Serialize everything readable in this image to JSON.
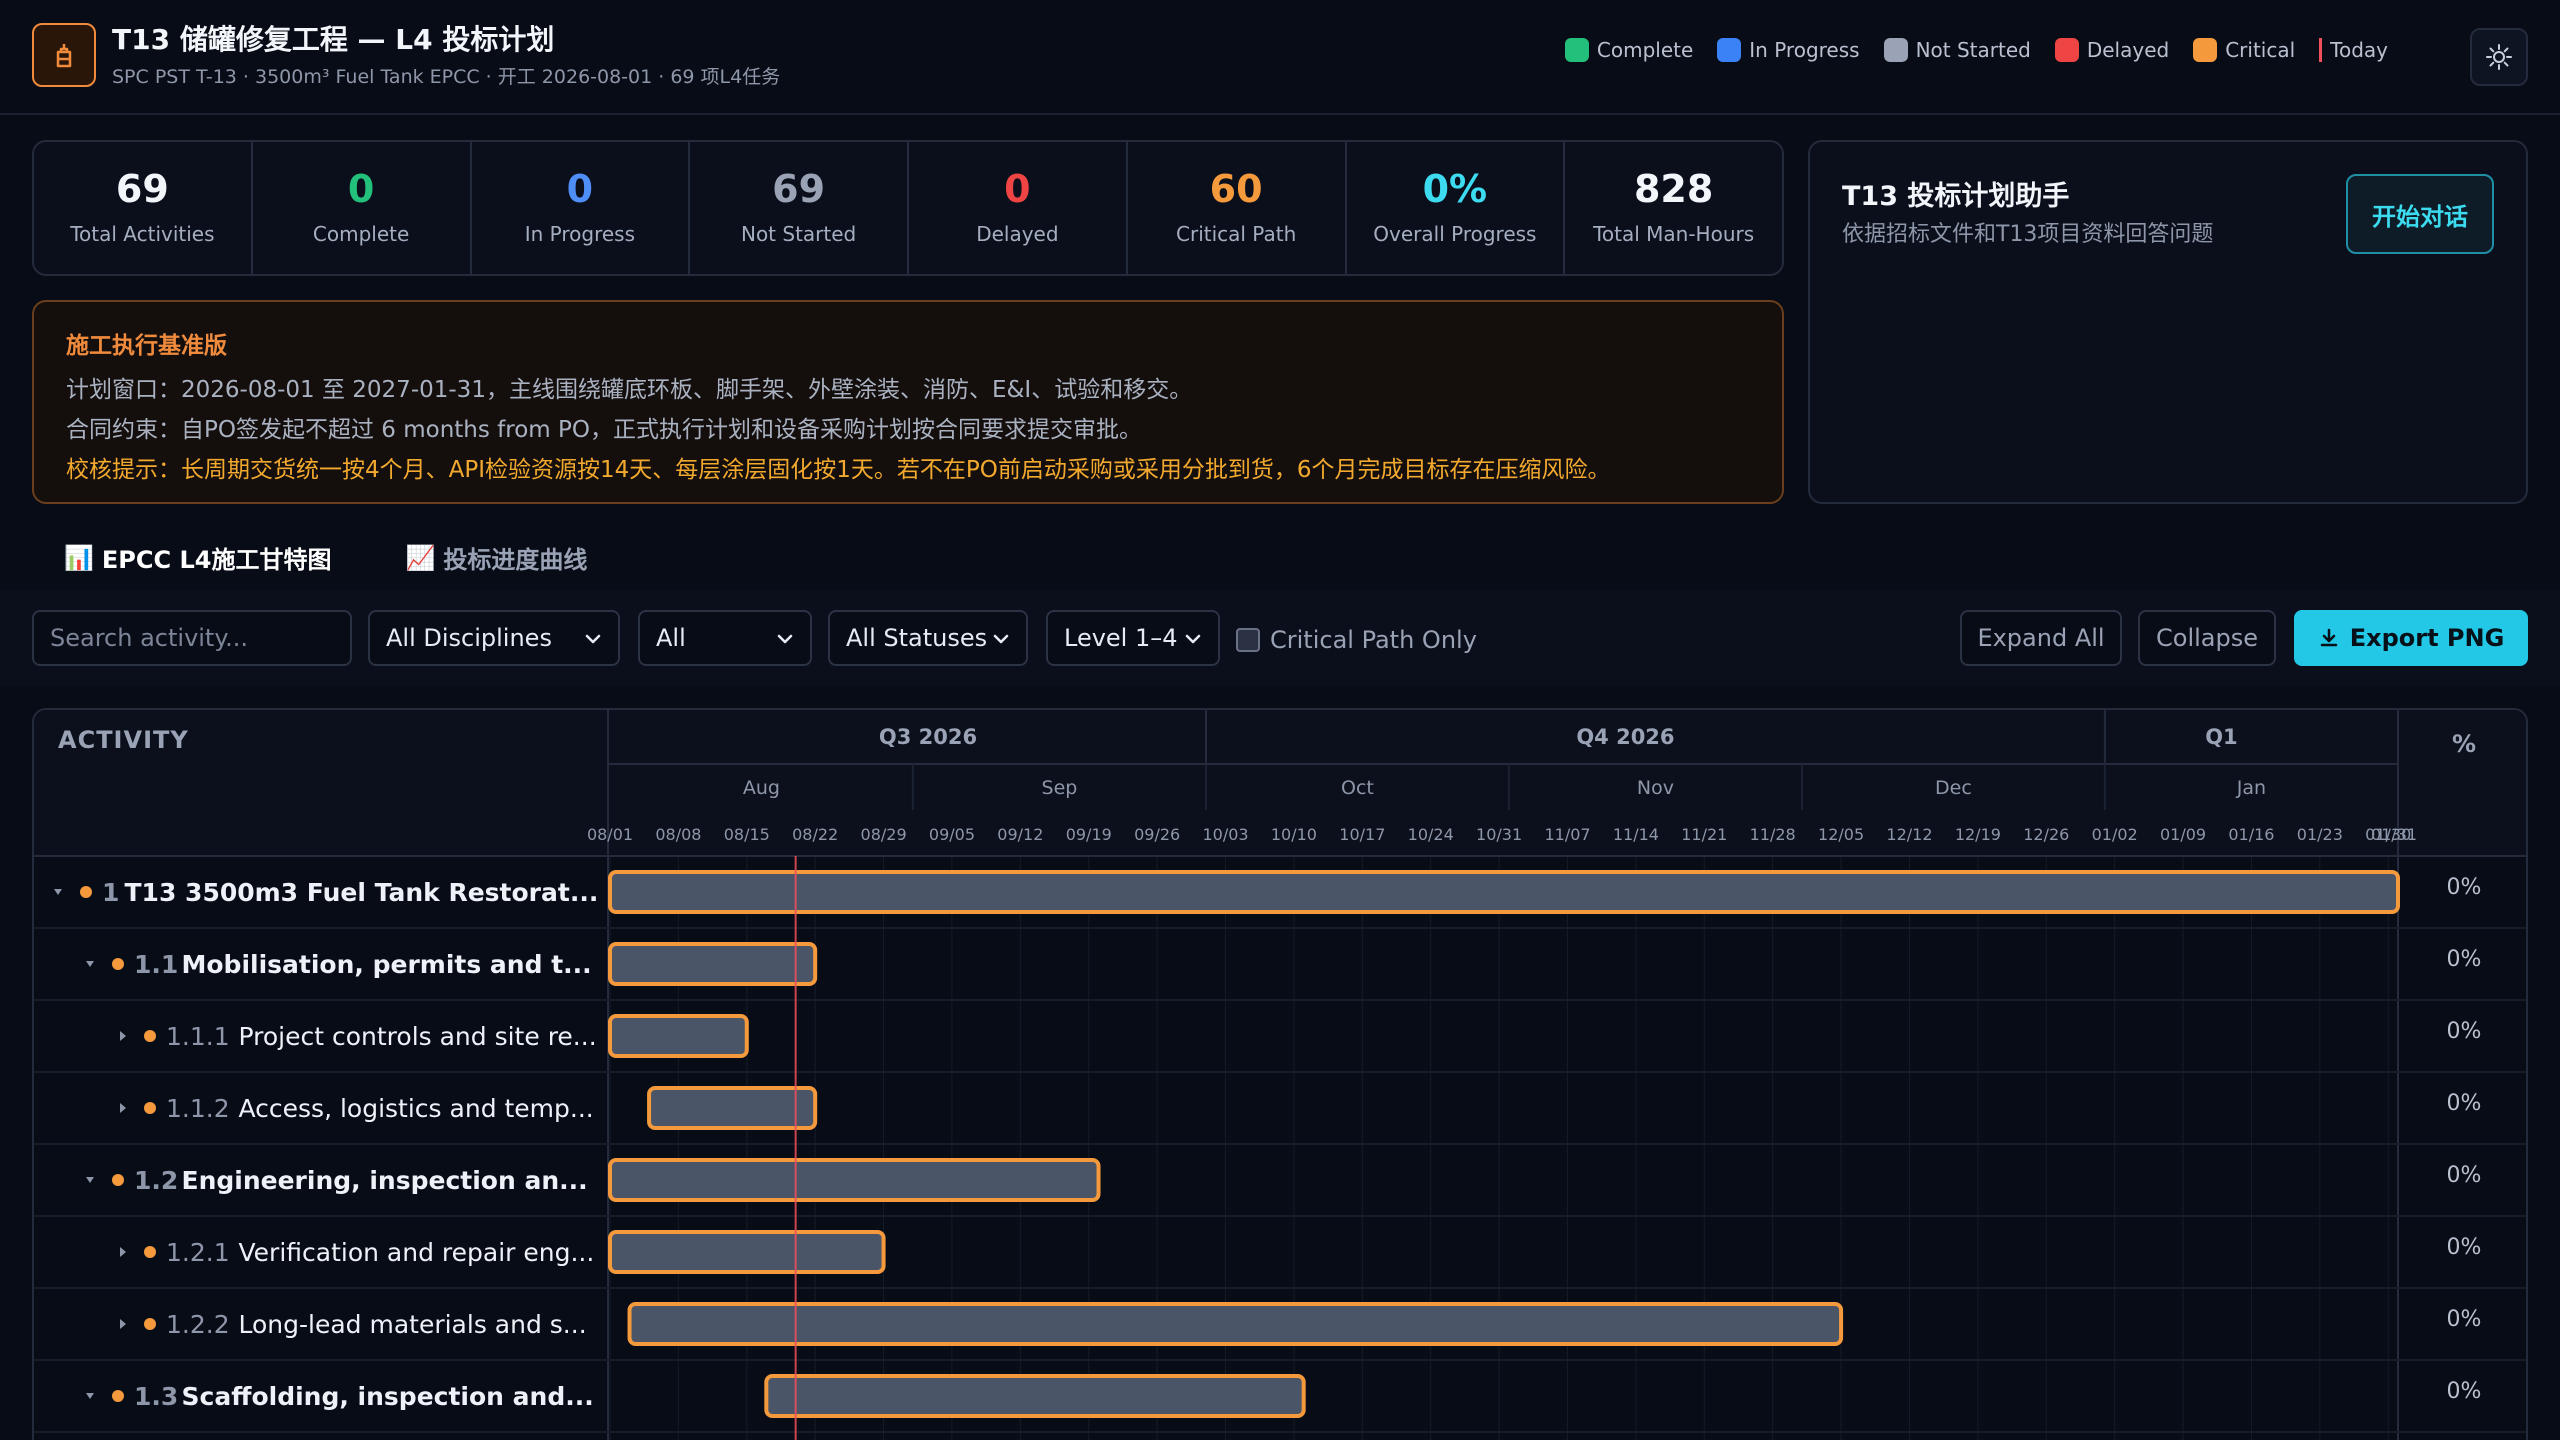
{
  "header": {
    "title": "T13 储罐修复工程 — L4 投标计划",
    "subtitle": "SPC PST T-13 · 3500m³ Fuel Tank EPCC · 开工 2026-08-01 · 69 项L4任务",
    "legend": [
      {
        "label": "Complete",
        "color": "#22c07a"
      },
      {
        "label": "In Progress",
        "color": "#3b82f6"
      },
      {
        "label": "Not Started",
        "color": "#9aa3b5"
      },
      {
        "label": "Delayed",
        "color": "#ef4444"
      },
      {
        "label": "Critical",
        "color": "#f59a3c"
      }
    ],
    "today_label": "Today"
  },
  "stats": [
    {
      "value": "69",
      "label": "Total Activities",
      "color": "#f2f5fa"
    },
    {
      "value": "0",
      "label": "Complete",
      "color": "#22c07a"
    },
    {
      "value": "0",
      "label": "In Progress",
      "color": "#4f8ef7"
    },
    {
      "value": "69",
      "label": "Not Started",
      "color": "#9aa3b5"
    },
    {
      "value": "0",
      "label": "Delayed",
      "color": "#ef4444"
    },
    {
      "value": "60",
      "label": "Critical Path",
      "color": "#f59a3c"
    },
    {
      "value": "0%",
      "label": "Overall Progress",
      "color": "#3ddbf0"
    },
    {
      "value": "828",
      "label": "Total Man-Hours",
      "color": "#f2f5fa"
    }
  ],
  "assistant": {
    "title": "T13 投标计划助手",
    "subtitle": "依据招标文件和T13项目资料回答问题",
    "button": "开始对话"
  },
  "notice": {
    "title": "施工执行基准版",
    "line1": "计划窗口：2026-08-01 至 2027-01-31，主线围绕罐底环板、脚手架、外壁涂装、消防、E&I、试验和移交。",
    "line2": "合同约束：自PO签发起不超过 6 months from PO，正式执行计划和设备采购计划按合同要求提交审批。",
    "warning": "校核提示：长周期交货统一按4个月、API检验资源按14天、每层涂层固化按1天。若不在PO前启动采购或采用分批到货，6个月完成目标存在压缩风险。"
  },
  "tabs": [
    {
      "icon": "📊",
      "label": "EPCC L4施工甘特图"
    },
    {
      "icon": "📈",
      "label": "投标进度曲线"
    }
  ],
  "toolbar": {
    "search_placeholder": "Search activity...",
    "discipline": "All Disciplines",
    "scope": "All",
    "status": "All Statuses",
    "level": "Level 1–4",
    "critical_only": "Critical Path Only",
    "expand": "Expand All",
    "collapse": "Collapse",
    "export": "Export PNG"
  },
  "gantt": {
    "activity_header": "ACTIVITY",
    "percent_header": "%",
    "quarters": [
      {
        "label": "Q3 2026",
        "start": "2026-07-01",
        "end": "2026-10-01"
      },
      {
        "label": "Q4 2026",
        "start": "2026-10-01",
        "end": "2027-01-01"
      },
      {
        "label": "Q1",
        "start": "2027-01-01",
        "end": "2027-04-01"
      }
    ],
    "months": [
      {
        "label": "Aug",
        "start": "2026-08-01",
        "end": "2026-09-01"
      },
      {
        "label": "Sep",
        "start": "2026-09-01",
        "end": "2026-10-01"
      },
      {
        "label": "Oct",
        "start": "2026-10-01",
        "end": "2026-11-01"
      },
      {
        "label": "Nov",
        "start": "2026-11-01",
        "end": "2026-12-01"
      },
      {
        "label": "Dec",
        "start": "2026-12-01",
        "end": "2027-01-01"
      },
      {
        "label": "Jan",
        "start": "2027-01-01",
        "end": "2027-02-01"
      }
    ],
    "weeks": [
      "08/01",
      "08/08",
      "08/15",
      "08/22",
      "08/29",
      "09/05",
      "09/12",
      "09/19",
      "09/26",
      "10/03",
      "10/10",
      "10/17",
      "10/24",
      "10/31",
      "11/07",
      "11/14",
      "11/21",
      "11/28",
      "12/05",
      "12/12",
      "12/19",
      "12/26",
      "01/02",
      "01/09",
      "01/16",
      "01/23",
      "01/30",
      "01/31"
    ],
    "today": "2026-08-20",
    "rows": [
      {
        "level": 0,
        "id": "1",
        "name": "T13 3500m3 Fuel Tank Restorat...",
        "bold": true,
        "expanded": true,
        "start": "2026-08-01",
        "end": "2027-01-31",
        "pct": "0%"
      },
      {
        "level": 1,
        "id": "1.1",
        "name": "Mobilisation, permits and t...",
        "bold": true,
        "expanded": true,
        "start": "2026-08-01",
        "end": "2026-08-22",
        "pct": "0%"
      },
      {
        "level": 2,
        "id": "1.1.1",
        "name": "Project controls and site re...",
        "bold": false,
        "expanded": false,
        "start": "2026-08-01",
        "end": "2026-08-15",
        "pct": "0%"
      },
      {
        "level": 2,
        "id": "1.1.2",
        "name": "Access, logistics and temp...",
        "bold": false,
        "expanded": false,
        "start": "2026-08-05",
        "end": "2026-08-22",
        "pct": "0%"
      },
      {
        "level": 1,
        "id": "1.2",
        "name": "Engineering, inspection an...",
        "bold": true,
        "expanded": true,
        "start": "2026-08-01",
        "end": "2026-09-20",
        "pct": "0%"
      },
      {
        "level": 2,
        "id": "1.2.1",
        "name": "Verification and repair eng...",
        "bold": false,
        "expanded": false,
        "start": "2026-08-01",
        "end": "2026-08-29",
        "pct": "0%"
      },
      {
        "level": 2,
        "id": "1.2.2",
        "name": "Long-lead materials and s...",
        "bold": false,
        "expanded": false,
        "start": "2026-08-03",
        "end": "2026-12-05",
        "pct": "0%"
      },
      {
        "level": 1,
        "id": "1.3",
        "name": "Scaffolding, inspection and...",
        "bold": true,
        "expanded": true,
        "start": "2026-08-17",
        "end": "2026-10-11",
        "pct": "0%"
      }
    ]
  }
}
